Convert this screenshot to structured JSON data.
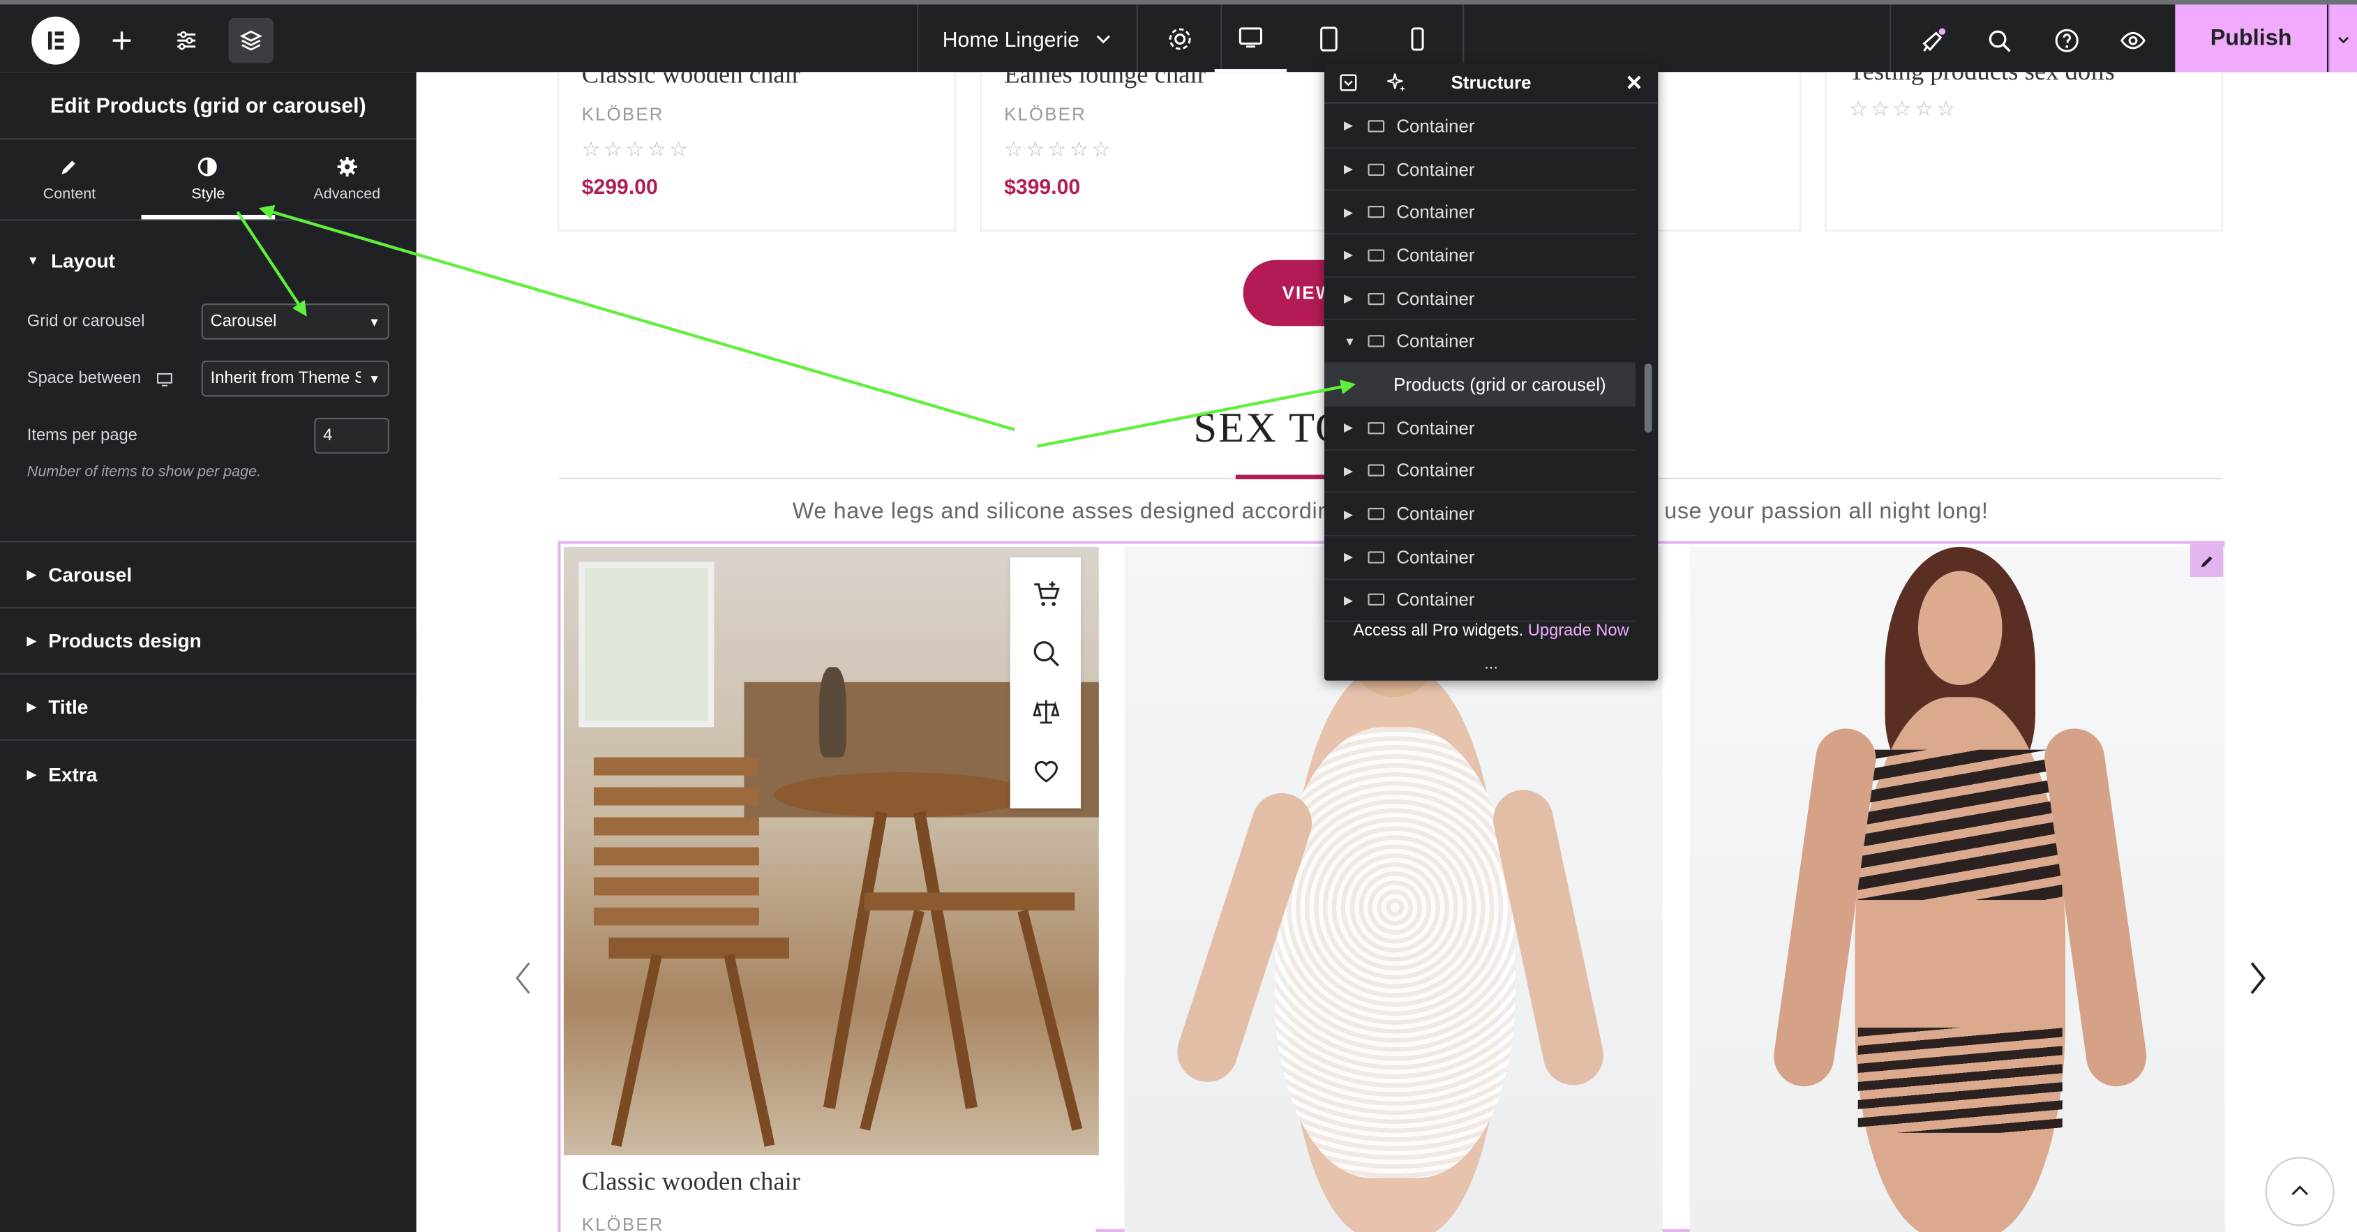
{
  "topbar": {
    "page_title": "Home Lingerie",
    "publish_label": "Publish"
  },
  "panel": {
    "title": "Edit Products (grid or carousel)",
    "tabs": [
      {
        "label": "Content"
      },
      {
        "label": "Style"
      },
      {
        "label": "Advanced"
      }
    ],
    "layout_heading": "Layout",
    "grid_label": "Grid or carousel",
    "grid_value": "Carousel",
    "space_label": "Space between",
    "space_value": "Inherit from Theme S",
    "items_label": "Items per page",
    "items_value": "4",
    "items_help": "Number of items to show per page.",
    "sections": [
      {
        "label": "Carousel"
      },
      {
        "label": "Products design"
      },
      {
        "label": "Title"
      },
      {
        "label": "Extra"
      }
    ]
  },
  "canvas": {
    "top_cards": [
      {
        "name": "Classic wooden chair",
        "brand": "KLÖBER",
        "price": "$299.00"
      },
      {
        "name": "Eames lounge chair",
        "brand": "KLÖBER",
        "price": "$399.00"
      },
      {
        "name": "Testing products sex dolls"
      }
    ],
    "stars": "☆☆☆☆☆",
    "view_button": "VIEW",
    "heading": "SEX TO",
    "description_left": "We have legs and silicone asses designed accordin",
    "description_right": "use your passion all night long!",
    "product_title": "Classic wooden chair",
    "product_brand": "KLÖBER"
  },
  "structure": {
    "title": "Structure",
    "items_before": [
      "Container",
      "Container",
      "Container",
      "Container",
      "Container",
      "Container"
    ],
    "child": "Products (grid or carousel)",
    "items_after": [
      "Container",
      "Container",
      "Container",
      "Container",
      "Container"
    ],
    "footer_text": "Access all Pro widgets.",
    "footer_link": "Upgrade Now",
    "dots": "..."
  },
  "colors": {
    "accent": "#b21b56",
    "publish": "#f0abfc",
    "panel_bg": "#1f2124",
    "annotation_arrow": "#5ef03a"
  }
}
